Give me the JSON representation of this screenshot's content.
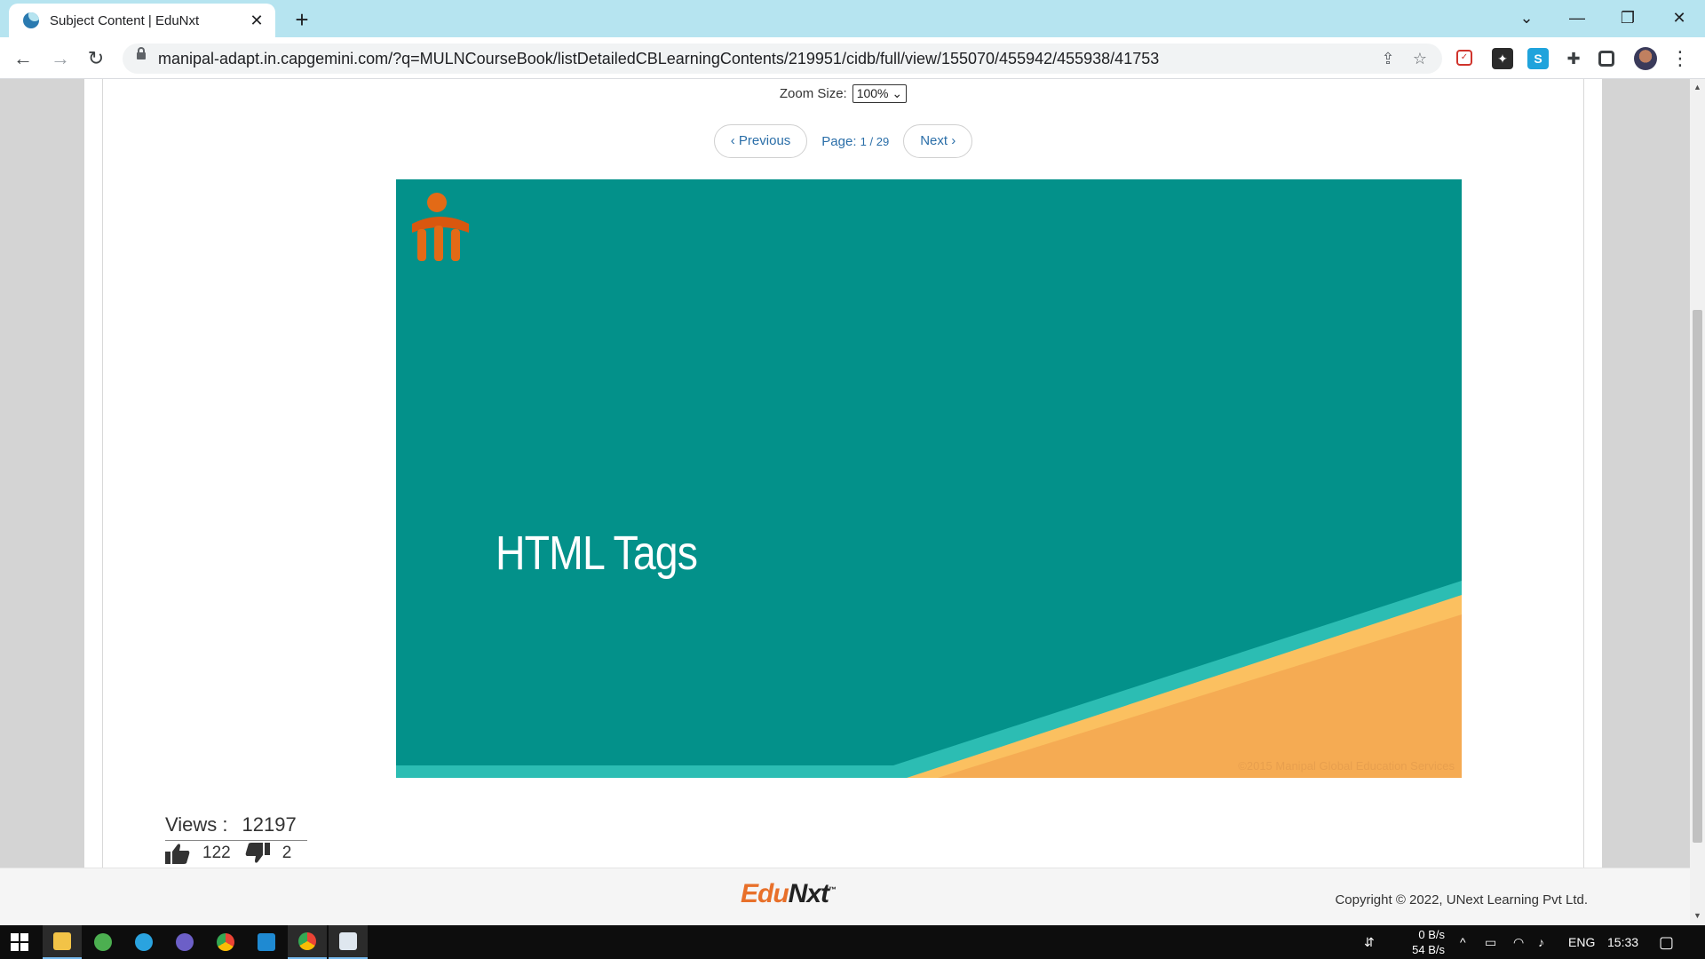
{
  "browser": {
    "tab_title": "Subject Content | EduNxt",
    "tab_close": "✕",
    "new_tab": "+",
    "url": "manipal-adapt.in.capgemini.com/?q=MULNCourseBook/listDetailedCBLearningContents/219951/cidb/full/view/155070/455942/455938/41753"
  },
  "viewer": {
    "zoom_label": "Zoom Size:",
    "zoom_value": "100%",
    "prev_label": "‹ Previous",
    "next_label": "Next ›",
    "page_label": "Page:",
    "page_current": "1",
    "page_total": "29"
  },
  "slide": {
    "title": "HTML Tags",
    "copyright": "©2015 Manipal Global Education Services",
    "colors": {
      "background": "#03918a",
      "stripe": "#2cbdb3",
      "orange": "#f5ab53",
      "light_orange": "#fbc060"
    }
  },
  "stats": {
    "views_label": "Views :",
    "views_count": "12197",
    "likes": "122",
    "dislikes": "2"
  },
  "footer": {
    "logo_edu": "Edu",
    "logo_nxt": "Nxt",
    "logo_tm": "™",
    "copyright": "Copyright © 2022, UNext Learning Pvt Ltd."
  },
  "taskbar": {
    "net_up": "0 B/s",
    "net_down": "54 B/s",
    "lang": "ENG",
    "time": "15:33"
  }
}
